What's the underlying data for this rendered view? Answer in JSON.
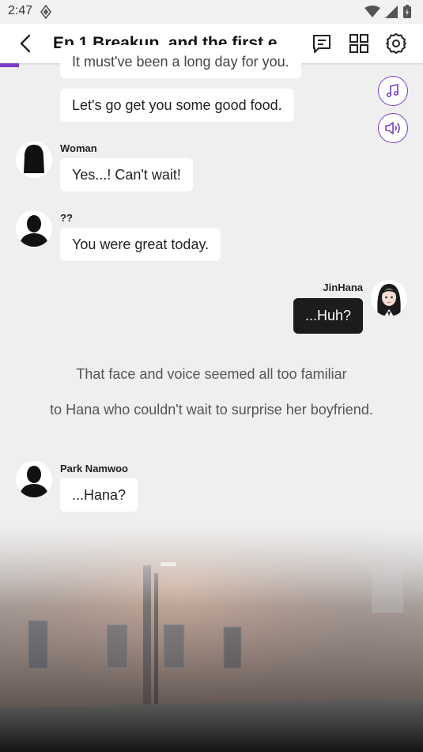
{
  "status_bar": {
    "time": "2:47"
  },
  "app_bar": {
    "title": "Ep.1 Breakup, and the first e..."
  },
  "progress": {
    "fraction": 0.045,
    "color": "#7a3fc4"
  },
  "messages": [
    {
      "text": "It must've been a long day for you.",
      "partial": true
    },
    {
      "text": "Let's go get you some good food."
    },
    {
      "sender": "Woman",
      "text": "Yes...! Can't wait!"
    },
    {
      "sender": "??",
      "text": "You were great today."
    },
    {
      "sender": "JinHana",
      "text": "...Huh?"
    },
    {
      "sender": "Park Namwoo",
      "text": "...Hana?"
    }
  ],
  "narration": [
    "That face and voice seemed all too familiar",
    "to Hana who couldn't wait to surprise her boyfriend."
  ],
  "icons": {
    "back": "back-arrow-icon",
    "chat_log": "chat-log-icon",
    "episodes": "grid-icon",
    "settings": "gear-icon",
    "music": "music-note-icon",
    "sound": "speaker-icon"
  }
}
